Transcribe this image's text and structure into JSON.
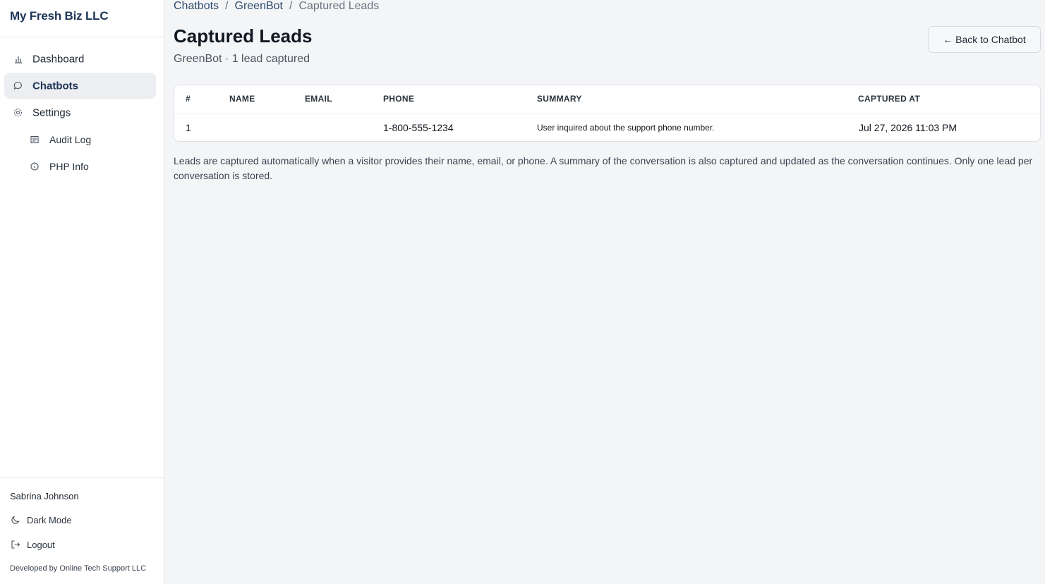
{
  "sidebar": {
    "brand": "My Fresh Biz LLC",
    "nav": [
      {
        "label": "Dashboard",
        "icon": "bar-chart-icon"
      },
      {
        "label": "Chatbots",
        "icon": "chat-bubble-icon",
        "active": true
      },
      {
        "label": "Settings",
        "icon": "gear-icon"
      },
      {
        "label": "Audit Log",
        "icon": "list-icon"
      },
      {
        "label": "PHP Info",
        "icon": "info-icon"
      }
    ],
    "user_name": "Sabrina Johnson",
    "dark_mode_label": "Dark Mode",
    "logout_label": "Logout",
    "credit": "Developed by Online Tech Support LLC"
  },
  "breadcrumb": {
    "items": [
      "Chatbots",
      "GreenBot"
    ],
    "current": "Captured Leads",
    "separator": "/"
  },
  "header": {
    "title": "Captured Leads",
    "subtitle": "GreenBot · 1 lead captured",
    "back_button": "← Back to Chatbot"
  },
  "table": {
    "columns": [
      "#",
      "NAME",
      "EMAIL",
      "PHONE",
      "SUMMARY",
      "CAPTURED AT"
    ],
    "rows": [
      {
        "num": "1",
        "name": "",
        "email": "",
        "phone": "1-800-555-1234",
        "summary": "User inquired about the support phone number.",
        "captured_at": "Jul 27, 2026 11:03 PM"
      }
    ]
  },
  "info_text": "Leads are captured automatically when a visitor provides their name, email, or phone. A summary of the conversation is also captured and updated as the conversation continues. Only one lead per conversation is stored.",
  "colors": {
    "brand": "#1d3557",
    "active_nav_bg": "#eceef1",
    "page_bg": "#f4f5f7"
  }
}
